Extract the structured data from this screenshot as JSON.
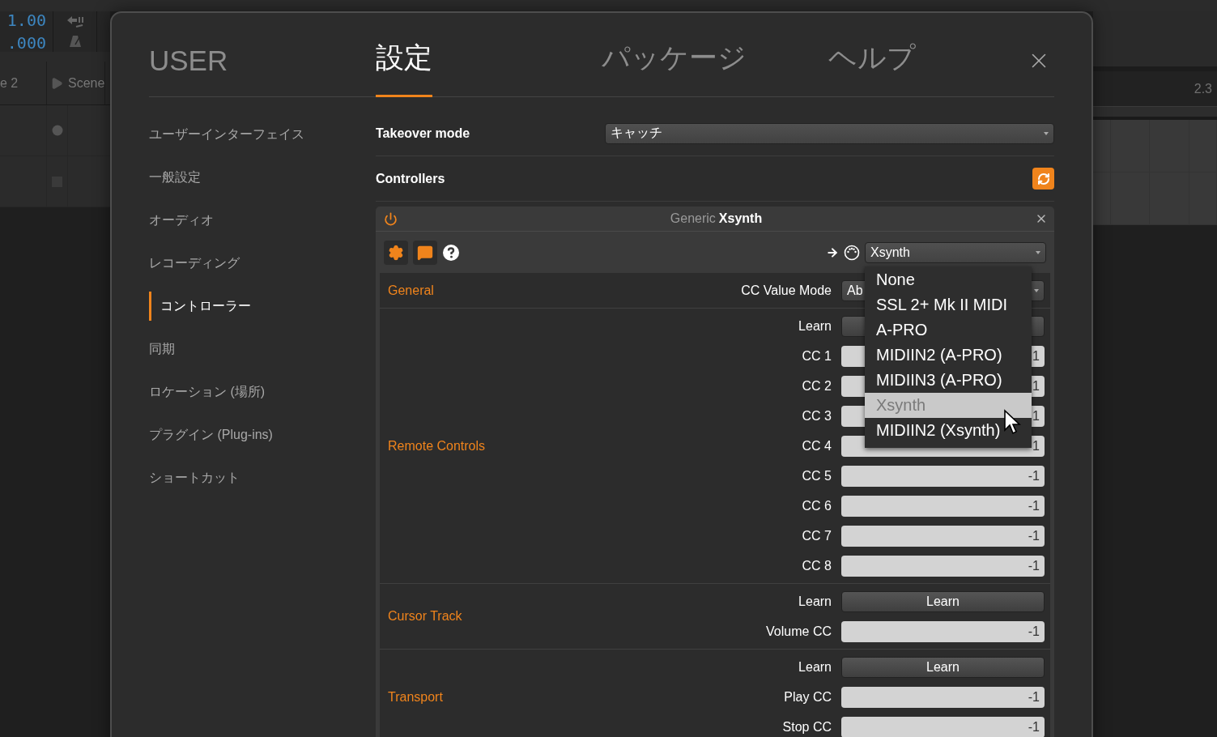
{
  "background": {
    "transport": [
      "1.00",
      ".000"
    ],
    "scenes": [
      "e 2",
      "Scene"
    ],
    "ruler": "2.3"
  },
  "dialog": {
    "tabs": [
      {
        "label": "USER",
        "selected": false
      },
      {
        "label": "設定",
        "selected": true
      },
      {
        "label": "パッケージ",
        "selected": false
      },
      {
        "label": "ヘルプ",
        "selected": false
      }
    ],
    "sidebar": [
      {
        "label": "ユーザーインターフェイス",
        "selected": false
      },
      {
        "label": "一般設定",
        "selected": false
      },
      {
        "label": "オーディオ",
        "selected": false
      },
      {
        "label": "レコーディング",
        "selected": false
      },
      {
        "label": "コントローラー",
        "selected": true
      },
      {
        "label": "同期",
        "selected": false
      },
      {
        "label": "ロケーション (場所)",
        "selected": false
      },
      {
        "label": "プラグイン (Plug-ins)",
        "selected": false
      },
      {
        "label": "ショートカット",
        "selected": false
      }
    ],
    "settings": [
      {
        "kind": "select",
        "label": "Takeover mode",
        "value": "キャッチ"
      },
      {
        "kind": "refresh",
        "label": "Controllers"
      }
    ],
    "controller": {
      "enabled": true,
      "vendor": "Generic",
      "name": "Xsynth",
      "port": "Xsynth",
      "sections": [
        {
          "title": "General",
          "rows": [
            {
              "kind": "select",
              "label": "CC Value Mode",
              "value": "Ab"
            }
          ]
        },
        {
          "title": "Remote Controls",
          "rows": [
            {
              "kind": "button",
              "label": "Learn"
            },
            {
              "kind": "field",
              "label": "CC 1",
              "value": "1"
            },
            {
              "kind": "field",
              "label": "CC 2",
              "value": "1"
            },
            {
              "kind": "field",
              "label": "CC 3",
              "value": "1"
            },
            {
              "kind": "field",
              "label": "CC 4",
              "value": "1"
            },
            {
              "kind": "field",
              "label": "CC 5",
              "value": "-1"
            },
            {
              "kind": "field",
              "label": "CC 6",
              "value": "-1"
            },
            {
              "kind": "field",
              "label": "CC 7",
              "value": "-1"
            },
            {
              "kind": "field",
              "label": "CC 8",
              "value": "-1"
            }
          ]
        },
        {
          "title": "Cursor Track",
          "rows": [
            {
              "kind": "button",
              "label": "Learn",
              "button": "Learn"
            },
            {
              "kind": "field",
              "label": "Volume CC",
              "value": "-1"
            }
          ]
        },
        {
          "title": "Transport",
          "rows": [
            {
              "kind": "button",
              "label": "Learn",
              "button": "Learn"
            },
            {
              "kind": "field",
              "label": "Play CC",
              "value": "-1"
            },
            {
              "kind": "field",
              "label": "Stop CC",
              "value": "-1"
            }
          ]
        }
      ]
    },
    "dropdown": [
      {
        "label": "None",
        "selected": false
      },
      {
        "label": "SSL 2+ Mk II MIDI",
        "selected": false
      },
      {
        "label": "A-PRO",
        "selected": false
      },
      {
        "label": "MIDIIN2 (A-PRO)",
        "selected": false
      },
      {
        "label": "MIDIIN3 (A-PRO)",
        "selected": false
      },
      {
        "label": "Xsynth",
        "selected": true
      },
      {
        "label": "MIDIIN2 (Xsynth)",
        "selected": false
      }
    ]
  }
}
